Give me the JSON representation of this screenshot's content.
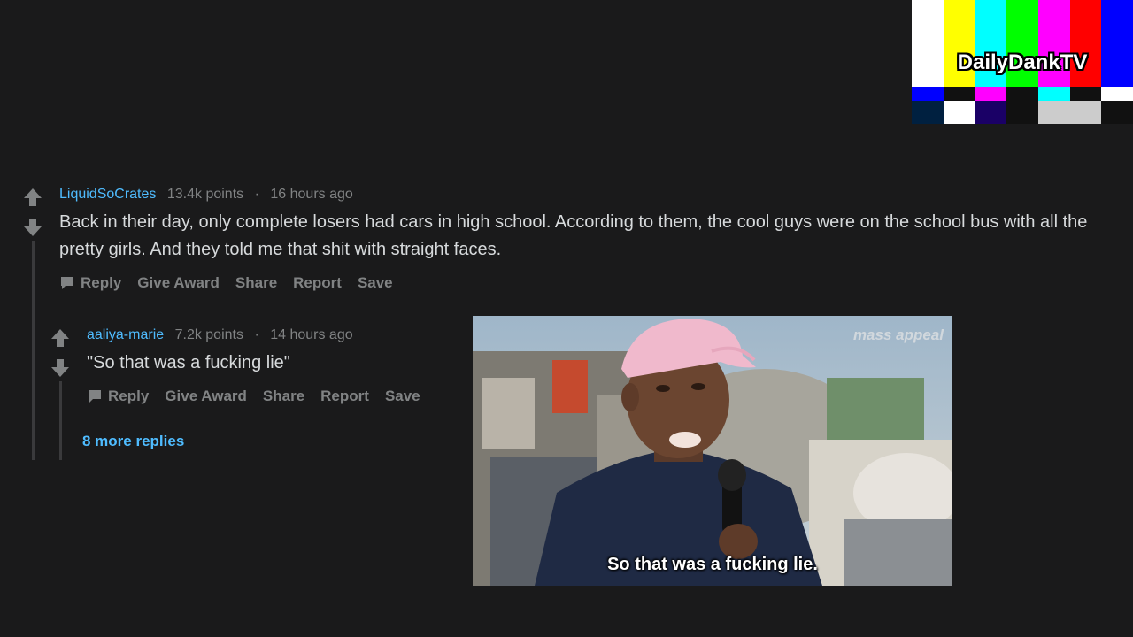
{
  "logo": {
    "text": "DailyDankTV",
    "top_bars": [
      "#ffffff",
      "#ffff00",
      "#00ffff",
      "#00ff00",
      "#ff00ff",
      "#ff0000",
      "#0000ff"
    ],
    "mid_bars": [
      "#0000ff",
      "#111111",
      "#ff00ff",
      "#111111",
      "#00ffff",
      "#111111",
      "#ffffff"
    ],
    "low_bars": [
      "#002040",
      "#ffffff",
      "#1a0066",
      "#111111",
      "#cccccc",
      "#cccccc",
      "#111111"
    ]
  },
  "comments": [
    {
      "username": "LiquidSoCrates",
      "points": "13.4k points",
      "separator": "·",
      "time": "16 hours ago",
      "text": "Back in their day, only complete losers had cars in high school. According to them, the cool guys were on the school bus with all the pretty girls. And they told me that shit with straight faces.",
      "actions": {
        "reply": "Reply",
        "give_award": "Give Award",
        "share": "Share",
        "report": "Report",
        "save": "Save"
      }
    },
    {
      "username": "aaliya-marie",
      "points": "7.2k points",
      "separator": "·",
      "time": "14 hours ago",
      "text": "\"So that was a fucking lie\"",
      "actions": {
        "reply": "Reply",
        "give_award": "Give Award",
        "share": "Share",
        "report": "Report",
        "save": "Save"
      },
      "more_replies": "8 more replies"
    }
  ],
  "image": {
    "caption": "So that was a fucking lie.",
    "watermark": "mass appeal"
  },
  "colors": {
    "background": "#1a1a1b",
    "username": "#4fbcff",
    "text": "#d7dadc",
    "muted": "#818384"
  }
}
